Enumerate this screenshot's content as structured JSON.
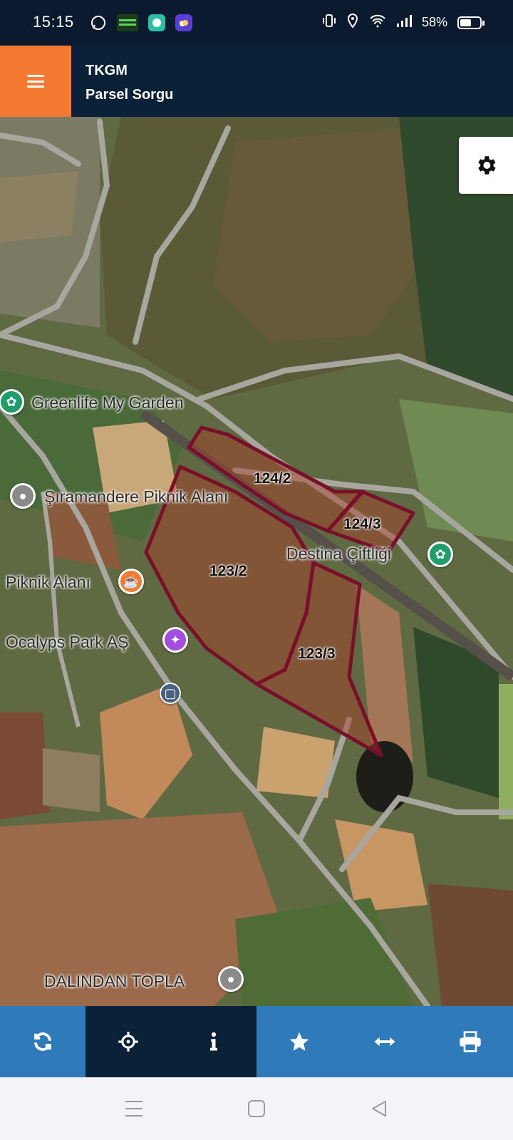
{
  "status_bar": {
    "time": "15:15",
    "battery_percent": "58%",
    "battery_level": 0.58,
    "left_icons": [
      "whatsapp-icon",
      "app-icon",
      "chat-app-icon",
      "weather-app-icon"
    ],
    "right_icons": [
      "vibrate-icon",
      "location-icon",
      "wifi-icon",
      "signal-icon",
      "battery-icon"
    ]
  },
  "header": {
    "menu_icon": "hamburger-menu-icon",
    "title": "TKGM",
    "subtitle": "Parsel Sorgu",
    "accent_color": "#f47a32",
    "bar_color": "#0b2138"
  },
  "map": {
    "settings_icon": "gear-icon",
    "parcel_outline_color": "#7a0f2a",
    "parcels": [
      {
        "label": "124/2"
      },
      {
        "label": "124/3"
      },
      {
        "label": "123/2"
      },
      {
        "label": "123/3"
      }
    ],
    "pois": [
      {
        "label": "Greenlife My Garden",
        "icon": "flower-pin-icon"
      },
      {
        "label": "Şıramandere Piknik Alanı",
        "icon": "grey-pin-icon"
      },
      {
        "label": "Destina Çiftliği",
        "icon": "flower-pin-icon"
      },
      {
        "label": "Piknik Alanı",
        "icon": "cafe-pin-icon"
      },
      {
        "label": "Ocalyps Park AŞ",
        "icon": "purple-pin-icon"
      },
      {
        "label": "DALINDAN TOPLA",
        "icon": "grey-pin-icon"
      }
    ]
  },
  "toolbar": {
    "buttons": [
      {
        "icon": "refresh-icon"
      },
      {
        "icon": "locate-icon"
      },
      {
        "icon": "info-icon"
      },
      {
        "icon": "star-icon"
      },
      {
        "icon": "measure-icon"
      },
      {
        "icon": "print-icon"
      }
    ],
    "primary_color": "#2f7ab8",
    "active_color": "#0b2138"
  },
  "nav_bar": {
    "buttons": [
      "recent-apps-icon",
      "home-icon",
      "back-icon"
    ]
  }
}
